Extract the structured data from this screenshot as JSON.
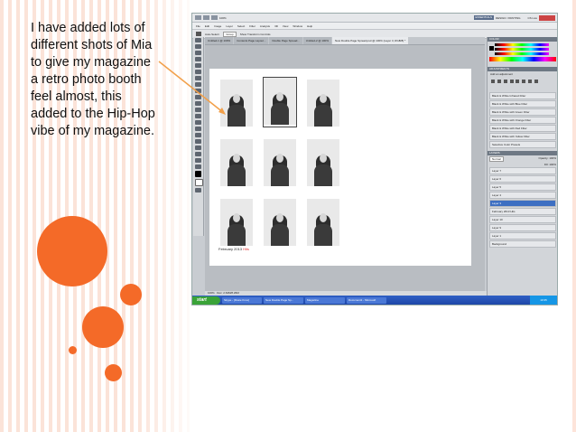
{
  "caption": {
    "lines": [
      "I have added lots of",
      "different shots of Mia",
      "to give my magazine",
      "a retro photo booth",
      "feel almost, this",
      "added to the Hip-Hop",
      "vibe of my magazine."
    ]
  },
  "accent_color": "#f46a28",
  "stripe_color": "#fbe3d8",
  "screenshot": {
    "titlebar": {
      "zoom": "100%",
      "workspace_button": "ESSENTIALS",
      "workspace_items": [
        "DESIGN",
        "PAINTING"
      ],
      "cs_live": "CS Live"
    },
    "menu": [
      "File",
      "Edit",
      "Image",
      "Layer",
      "Select",
      "Filter",
      "Analysis",
      "3D",
      "View",
      "Window",
      "Help"
    ],
    "options": {
      "auto_select": "Auto-Select:",
      "auto_select_value": "Group",
      "show_transform": "Show Transform Controls"
    },
    "tabs": [
      "Untitled-1 @ 100%",
      "Contents Page Layout...",
      "Double Page Spread...",
      "Untitled-2 @ 100%",
      "New Double Page Spread.psd @ 100% (Layer 3, RGB/8) *"
    ],
    "document_footer_text": "February 2013",
    "document_footer_accent": "Hits",
    "status_zoom": "100%",
    "status_doc": "Doc: 2.64M/8.29M",
    "panels": {
      "color_header": "COLOR",
      "adjustments_header": "ADJUSTMENTS",
      "add_adjustment": "Add an adjustment",
      "presets": [
        "Black & White Infrared Filter",
        "Black & White with Blue Filter",
        "Black & White with Green Filter",
        "Black & White with Orange Filter",
        "Black & White with Red Filter",
        "Black & White with Yellow Filter",
        "Selective Color Presets"
      ],
      "layers_header": "LAYERS",
      "blend_mode": "Normal",
      "opacity": "Opacity: 100%",
      "fill": "Fill: 100%",
      "layers": [
        {
          "name": "Layer 7",
          "selected": false
        },
        {
          "name": "Layer 6",
          "selected": false
        },
        {
          "name": "Layer 5",
          "selected": false
        },
        {
          "name": "Layer 4",
          "selected": false
        },
        {
          "name": "Layer 3",
          "selected": true
        },
        {
          "name": "February 2013  Hits",
          "selected": false
        },
        {
          "name": "Layer 10",
          "selected": false
        },
        {
          "name": "Layer 9",
          "selected": false
        },
        {
          "name": "Layer 1",
          "selected": false
        },
        {
          "name": "Background",
          "selected": false
        }
      ]
    },
    "taskbar": {
      "start": "start",
      "tasks": [
        "Skype - [Rosie Knox]",
        "New Double Page Sp...",
        "Magazine",
        "Document1 - Microsoft"
      ],
      "clock": "10:35"
    }
  }
}
